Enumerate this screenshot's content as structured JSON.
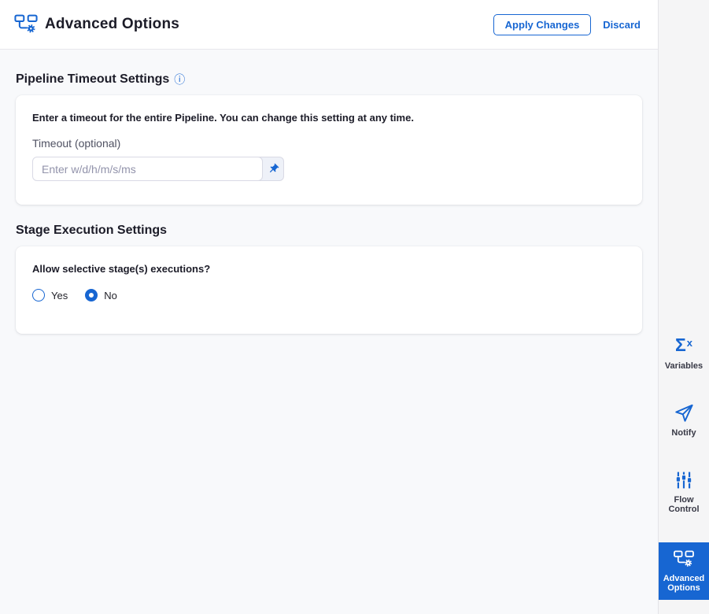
{
  "colors": {
    "accent": "#1766D2",
    "text_dark": "#1C1C28",
    "label_gray": "#4F5162",
    "placeholder_gray": "#9293AB",
    "input_border": "#D9DAE5",
    "content_bg": "#F8F9FB",
    "sidebar_bg": "#F5F5F6",
    "active_item_bg": "#1766D2",
    "card_bg": "#FFFFFF"
  },
  "header": {
    "title": "Advanced Options",
    "apply_label": "Apply Changes",
    "discard_label": "Discard"
  },
  "sections": {
    "timeout": {
      "heading": "Pipeline Timeout Settings",
      "description": "Enter a timeout for the entire Pipeline. You can change this setting at any time.",
      "field_label": "Timeout (optional)",
      "input_value": "",
      "input_placeholder": "Enter w/d/h/m/s/ms"
    },
    "stage_execution": {
      "heading": "Stage Execution Settings",
      "question": "Allow selective stage(s) executions?",
      "options": [
        {
          "label": "Yes",
          "selected": false
        },
        {
          "label": "No",
          "selected": true
        }
      ]
    }
  },
  "sidebar": {
    "items": [
      {
        "label": "Variables",
        "icon": "sigma-x-icon",
        "active": false
      },
      {
        "label": "Notify",
        "icon": "paper-plane-icon",
        "active": false
      },
      {
        "label": "Flow Control",
        "icon": "sliders-icon",
        "active": false
      },
      {
        "label": "Advanced Options",
        "icon": "pipeline-gear-icon",
        "active": true
      }
    ]
  }
}
